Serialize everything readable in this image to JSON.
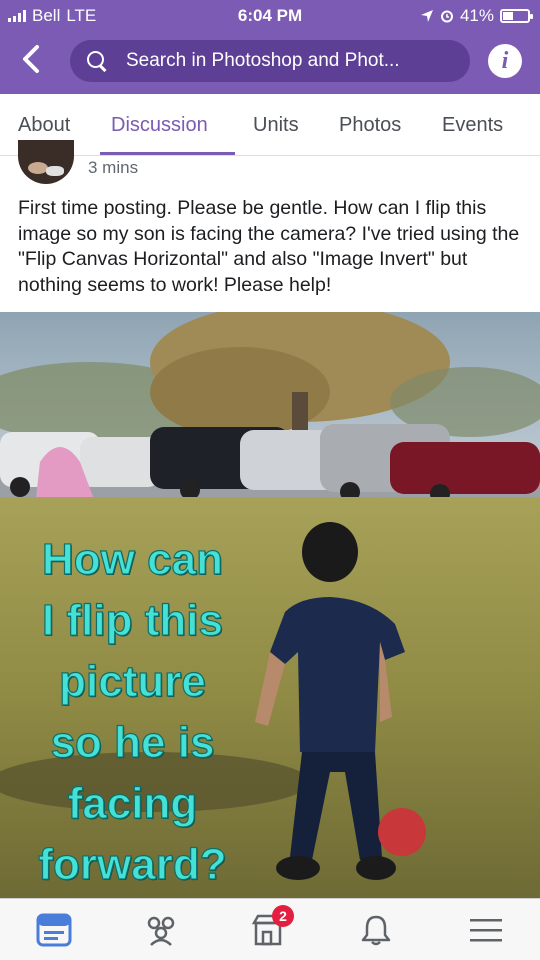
{
  "status_bar": {
    "carrier": "Bell",
    "network": "LTE",
    "time": "6:04 PM",
    "battery": "41%",
    "battery_level": 0.41
  },
  "search": {
    "placeholder": "Search in Photoshop and Phot..."
  },
  "tabs": [
    {
      "label": "About"
    },
    {
      "label": "Discussion",
      "active": true
    },
    {
      "label": "Units"
    },
    {
      "label": "Photos"
    },
    {
      "label": "Events"
    }
  ],
  "post": {
    "time": "3 mins",
    "text": "First time posting. Please be gentle.  How can I flip this image so my son is facing the camera?  I've tried using the \"Flip Canvas Horizontal\" and also \"Image Invert\" but nothing seems to work!  Please help!",
    "image_overlay_lines": [
      "How can",
      "I flip this",
      "picture",
      "so he is",
      "facing",
      "forward?"
    ]
  },
  "bottom_nav": {
    "items": [
      {
        "icon": "news-feed-icon",
        "active": true
      },
      {
        "icon": "groups-icon"
      },
      {
        "icon": "marketplace-icon",
        "badge": "2"
      },
      {
        "icon": "notifications-bell-icon"
      },
      {
        "icon": "menu-icon"
      }
    ]
  },
  "colors": {
    "header_bg": "#7b5bb3",
    "search_bg": "#5d3f95",
    "active_tab": "#7b5bb3",
    "active_nav": "#4a7cd9",
    "badge": "#e41e3f",
    "overlay_text": "#45e0d6"
  }
}
